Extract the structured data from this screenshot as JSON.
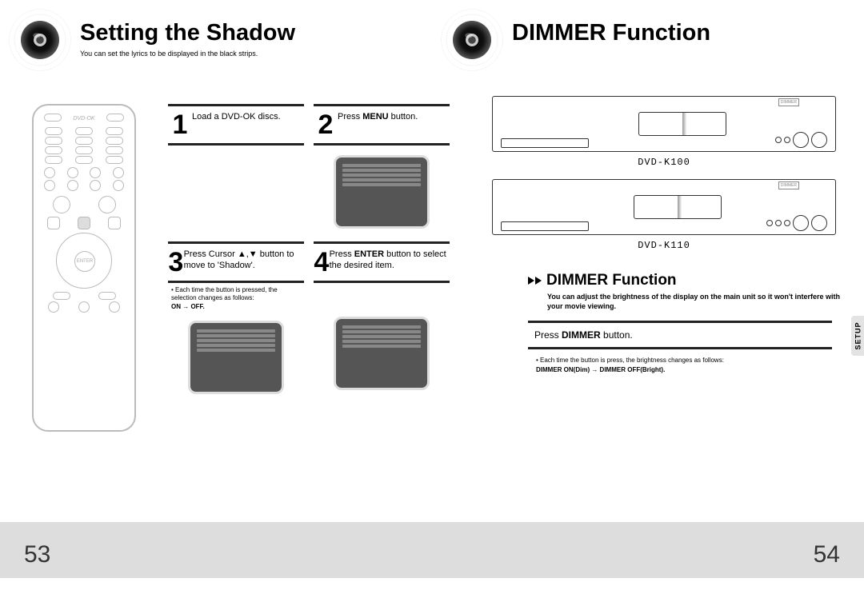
{
  "left": {
    "title": "Setting the Shadow",
    "subtitle": "You can set the lyrics to be displayed in the black strips.",
    "steps": [
      {
        "num": "1",
        "html": "Load a DVD-OK discs."
      },
      {
        "num": "2",
        "html": "Press <b>MENU</b> button."
      },
      {
        "num": "3",
        "html": "Press Cursor ▲,▼ button to move to 'Shadow'."
      },
      {
        "num": "4",
        "html": "Press <b>ENTER</b> button to select the desired item."
      }
    ],
    "step3_note_line1": "• Each time the button is pressed, the selection changes as follows:",
    "step3_note_line2": "ON → OFF.",
    "page_num": "53"
  },
  "right": {
    "title": "DIMMER Function",
    "model1": "DVD-K100",
    "model2": "DVD-K110",
    "dimmer_label": "DIMMER",
    "section_title": "DIMMER Function",
    "section_desc": "You can adjust the brightness of the display on the main unit so it won't interfere with your movie viewing.",
    "instruction_pre": "Press ",
    "instruction_bold": "DIMMER",
    "instruction_post": " button.",
    "note_line1": "• Each time the button is press, the brightness changes as follows:",
    "note_line2": "DIMMER ON(Dim) → DIMMER OFF(Bright).",
    "side_tab": "SETUP",
    "page_num": "54"
  },
  "remote_logo": "DVD-OK"
}
